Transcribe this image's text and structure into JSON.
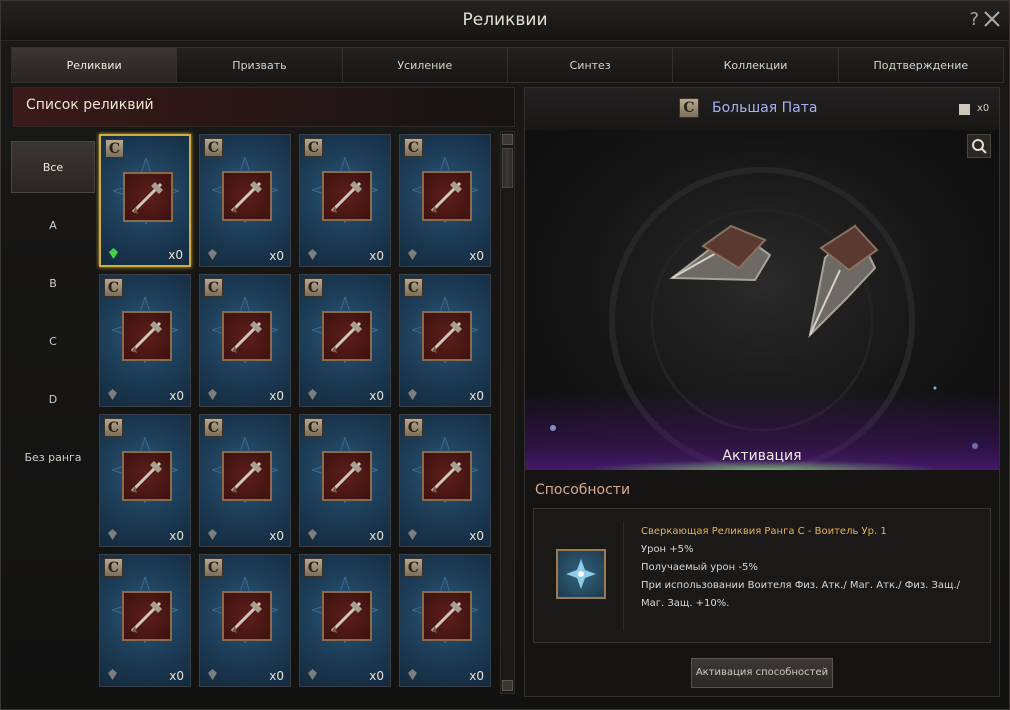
{
  "window": {
    "title": "Реликвии"
  },
  "tabs": [
    {
      "label": "Реликвии",
      "active": true
    },
    {
      "label": "Призвать"
    },
    {
      "label": "Усиление"
    },
    {
      "label": "Синтез"
    },
    {
      "label": "Коллекции"
    },
    {
      "label": "Подтверждение"
    }
  ],
  "list": {
    "title": "Список реликвий"
  },
  "filters": [
    {
      "label": "Все",
      "active": true
    },
    {
      "label": "A"
    },
    {
      "label": "B"
    },
    {
      "label": "C"
    },
    {
      "label": "D"
    },
    {
      "label": "Без ранга"
    }
  ],
  "cards": [
    {
      "rank": "C",
      "count": "x0",
      "icon": "halberd-icon",
      "gem": "green",
      "selected": true
    },
    {
      "rank": "C",
      "count": "x0",
      "icon": "cannon-blade-icon",
      "gem": "grey"
    },
    {
      "rank": "C",
      "count": "x0",
      "icon": "fire-sword-icon",
      "gem": "grey"
    },
    {
      "rank": "C",
      "count": "x0",
      "icon": "long-sword-icon",
      "gem": "grey"
    },
    {
      "rank": "C",
      "count": "x0",
      "icon": "greatsword-icon",
      "gem": "grey"
    },
    {
      "rank": "C",
      "count": "x0",
      "icon": "club-icon",
      "gem": "grey"
    },
    {
      "rank": "C",
      "count": "x0",
      "icon": "crossed-swords-icon",
      "gem": "grey"
    },
    {
      "rank": "C",
      "count": "x0",
      "icon": "crossed-swords-icon",
      "gem": "grey"
    },
    {
      "rank": "C",
      "count": "x0",
      "icon": "hammer-icon",
      "gem": "grey"
    },
    {
      "rank": "C",
      "count": "x0",
      "icon": "axe-icon",
      "gem": "grey"
    },
    {
      "rank": "C",
      "count": "x0",
      "icon": "double-axe-icon",
      "gem": "grey"
    },
    {
      "rank": "C",
      "count": "x0",
      "icon": "war-hammer-icon",
      "gem": "grey"
    },
    {
      "rank": "C",
      "count": "x0",
      "icon": "poleaxe-icon",
      "gem": "grey"
    },
    {
      "rank": "C",
      "count": "x0",
      "icon": "bow-icon",
      "gem": "grey"
    },
    {
      "rank": "C",
      "count": "x0",
      "icon": "battle-axe-icon",
      "gem": "grey"
    },
    {
      "rank": "C",
      "count": "x0",
      "icon": "spear-icon",
      "gem": "grey"
    }
  ],
  "detail": {
    "rank": "C",
    "name": "Большая Пата",
    "owned": "x0",
    "activation_label": "Активация",
    "abilities_title": "Способности",
    "ability": {
      "heading": "Сверкающая Реликвия Ранга C - Воитель Ур. 1",
      "lines": [
        "Урон +5%",
        "Получаемый урон -5%",
        "При использовании Воителя Физ. Атк./ Маг. Атк./ Физ. Защ./",
        "Маг. Защ. +10%."
      ]
    },
    "activate_button": "Активация способностей"
  },
  "colors": {
    "selected_border": "#cfae3a",
    "name": "#a5b2f2",
    "ability_heading": "#e8b24a",
    "gem_green": "#3fd34a"
  }
}
